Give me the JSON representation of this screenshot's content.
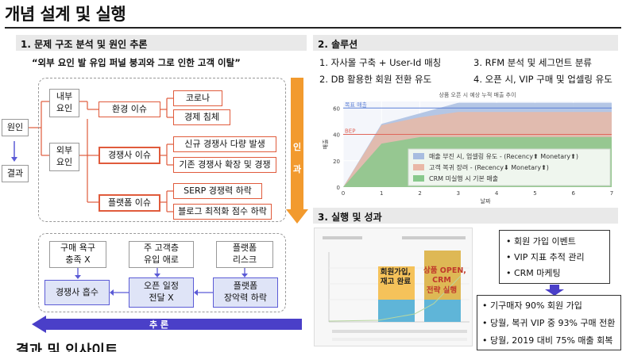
{
  "page_title": "개념 설계 및 실행",
  "section1": {
    "heading": "1. 문제 구조 분석 및 원인 추론",
    "quote": "“외부 요인 발 유입 퍼널 붕괴와 그로 인한 고객 이탈”",
    "cause": "원인",
    "result": "결과",
    "internal": "내부\n요인",
    "external": "외부\n요인",
    "issues": {
      "env": "환경 이슈",
      "competitor": "경쟁사 이슈",
      "platform": "플랫폼 이슈"
    },
    "leaves": {
      "corona": "코로나",
      "economy": "경제 침체",
      "new_comp": "신규 경쟁사 다량 발생",
      "exist_comp": "기존 경쟁사 확장 및 경쟁",
      "serp": "SERP 경쟁력 하락",
      "blog": "블로그 최적화 점수 하락"
    },
    "induction_arrow": "인\n과",
    "inference_arrow": "추 론",
    "bottom": {
      "top_row": [
        "구매 욕구\n충족 X",
        "주 고객층\n유입 애로",
        "플랫폼\n리스크"
      ],
      "bottom_row": [
        "경쟁사 흡수",
        "오픈 일정\n전달 X",
        "플랫폼\n장악력 하락"
      ]
    }
  },
  "section2": {
    "heading": "2. 솔루션",
    "items": [
      "1.  자사몰 구축 + User-Id 매칭",
      "3.  RFM 분석 및 세그먼트 분류",
      "2.  DB 활용한 회원 전환 유도",
      "4.  오픈 시, VIP 구매 및 업셀링 유도"
    ]
  },
  "section3": {
    "heading": "3. 실행 및 성과",
    "bar_labels": [
      "회원가입,\n재고 완료",
      "상품 OPEN,\nCRM\n전략 실행"
    ],
    "actions": [
      "• 회원 가입 이벤트",
      "• VIP 지표 추적 관리",
      "• CRM 마케팅"
    ],
    "results": [
      "• 기구매자 90% 회원 가입",
      "• 당월, 복귀 VIP 중 93% 구매 전환",
      "• 당월, 2019 대비 75% 매출 회복"
    ]
  },
  "next_section_title": "결과 및 인사이트",
  "chart_data": {
    "type": "area",
    "title": "상품 오픈 시 예상 누적 매출 추이",
    "xlabel": "날짜",
    "ylabel": "매출",
    "xlim": [
      0,
      7
    ],
    "ylim": [
      0,
      65
    ],
    "x": [
      0,
      1,
      2,
      3,
      4,
      5,
      6,
      7
    ],
    "xticks": [
      0,
      1,
      2,
      3,
      4,
      5,
      6,
      7
    ],
    "yticks": [
      0,
      20,
      40,
      60
    ],
    "reference_lines": [
      {
        "label": "목표 매출",
        "value": 60,
        "color": "#5b7fd6"
      },
      {
        "label": "BEP",
        "value": 40,
        "color": "#e0665a"
      }
    ],
    "series": [
      {
        "name": "매출 부진 시, 업셀링 유도 - (Recency⬆ Monetary⬆)",
        "values": [
          0,
          48,
          56,
          64,
          64,
          64,
          64,
          64
        ],
        "color": "#a8bde0"
      },
      {
        "name": "고객 복귀 장려 - (Recency⬇ Monetary⬆)",
        "values": [
          0,
          47,
          53,
          57,
          57,
          57,
          57,
          57
        ],
        "color": "#e9b8a6"
      },
      {
        "name": "CRM 미실행 시 기본 매출",
        "values": [
          0,
          33,
          38,
          38,
          38,
          38,
          38,
          38
        ],
        "color": "#88c98c"
      }
    ],
    "legend_position": "bottom-right",
    "grid": true,
    "accent_colors": {
      "dark_green": "#3f7d3f"
    }
  }
}
